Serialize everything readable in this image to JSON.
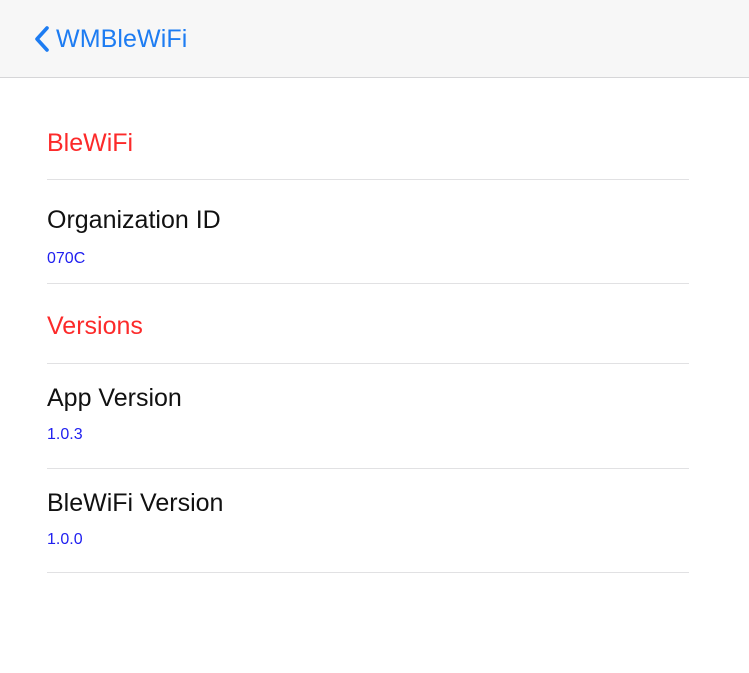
{
  "navbar": {
    "back_label": "WMBleWiFi",
    "back_icon": "chevron-left-icon",
    "accent_color": "#1d7cf2"
  },
  "sections": [
    {
      "title": "BleWiFi",
      "rows": [
        {
          "title": "Organization ID",
          "value": "070C"
        }
      ]
    },
    {
      "title": "Versions",
      "rows": [
        {
          "title": "App Version",
          "value": "1.0.3"
        },
        {
          "title": "BleWiFi Version",
          "value": "1.0.0"
        }
      ]
    }
  ],
  "colors": {
    "section_title": "#fc2a2a",
    "value_text": "#2020f0"
  }
}
